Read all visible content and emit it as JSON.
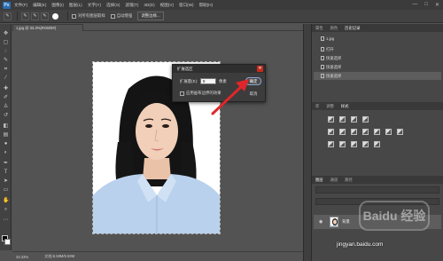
{
  "menubar": {
    "logo": "Ps",
    "items": [
      "文件(F)",
      "编辑(E)",
      "图像(I)",
      "图层(L)",
      "文字(Y)",
      "选择(S)",
      "滤镜(T)",
      "3D(D)",
      "视图(V)",
      "窗口(W)",
      "帮助(H)"
    ],
    "window_controls": [
      "—",
      "□",
      "✕"
    ]
  },
  "options_bar": {
    "checkbox_sample_all": "对所有图层取样",
    "checkbox_auto_enhance": "自动增强",
    "refine_edge": "调整边缘..."
  },
  "document": {
    "tab_title": "1.jpg @ 33.3%(RGB/8#)",
    "zoom": "33.33%",
    "doc_info": "文档:6.59M/6.59M"
  },
  "dialog": {
    "title": "扩展选区",
    "expand_label": "扩展量(E):",
    "expand_value": "8",
    "unit": "像素",
    "apply_canvas_bounds": "应用画布边界的效果",
    "ok_label": "确定",
    "cancel_label": "取消"
  },
  "history_panel": {
    "tabs": [
      "属性",
      "颜色",
      "历史记录"
    ],
    "snapshot": "1.jpg",
    "items": [
      {
        "label": "打开"
      },
      {
        "label": "快速选择"
      },
      {
        "label": "快速选择"
      },
      {
        "label": "快速选择"
      }
    ]
  },
  "adjustments_panel": {
    "tabs": [
      "库",
      "调整",
      "样式"
    ]
  },
  "layers_panel": {
    "tabs": [
      "图层",
      "通道",
      "路径"
    ],
    "layer_name": "背景"
  },
  "watermark": {
    "site": "jingyan.baidu.com",
    "brand": "Baidu 经验"
  },
  "colors": {
    "ok_highlight": "#8aa9d8",
    "arrow": "#e0262a"
  }
}
